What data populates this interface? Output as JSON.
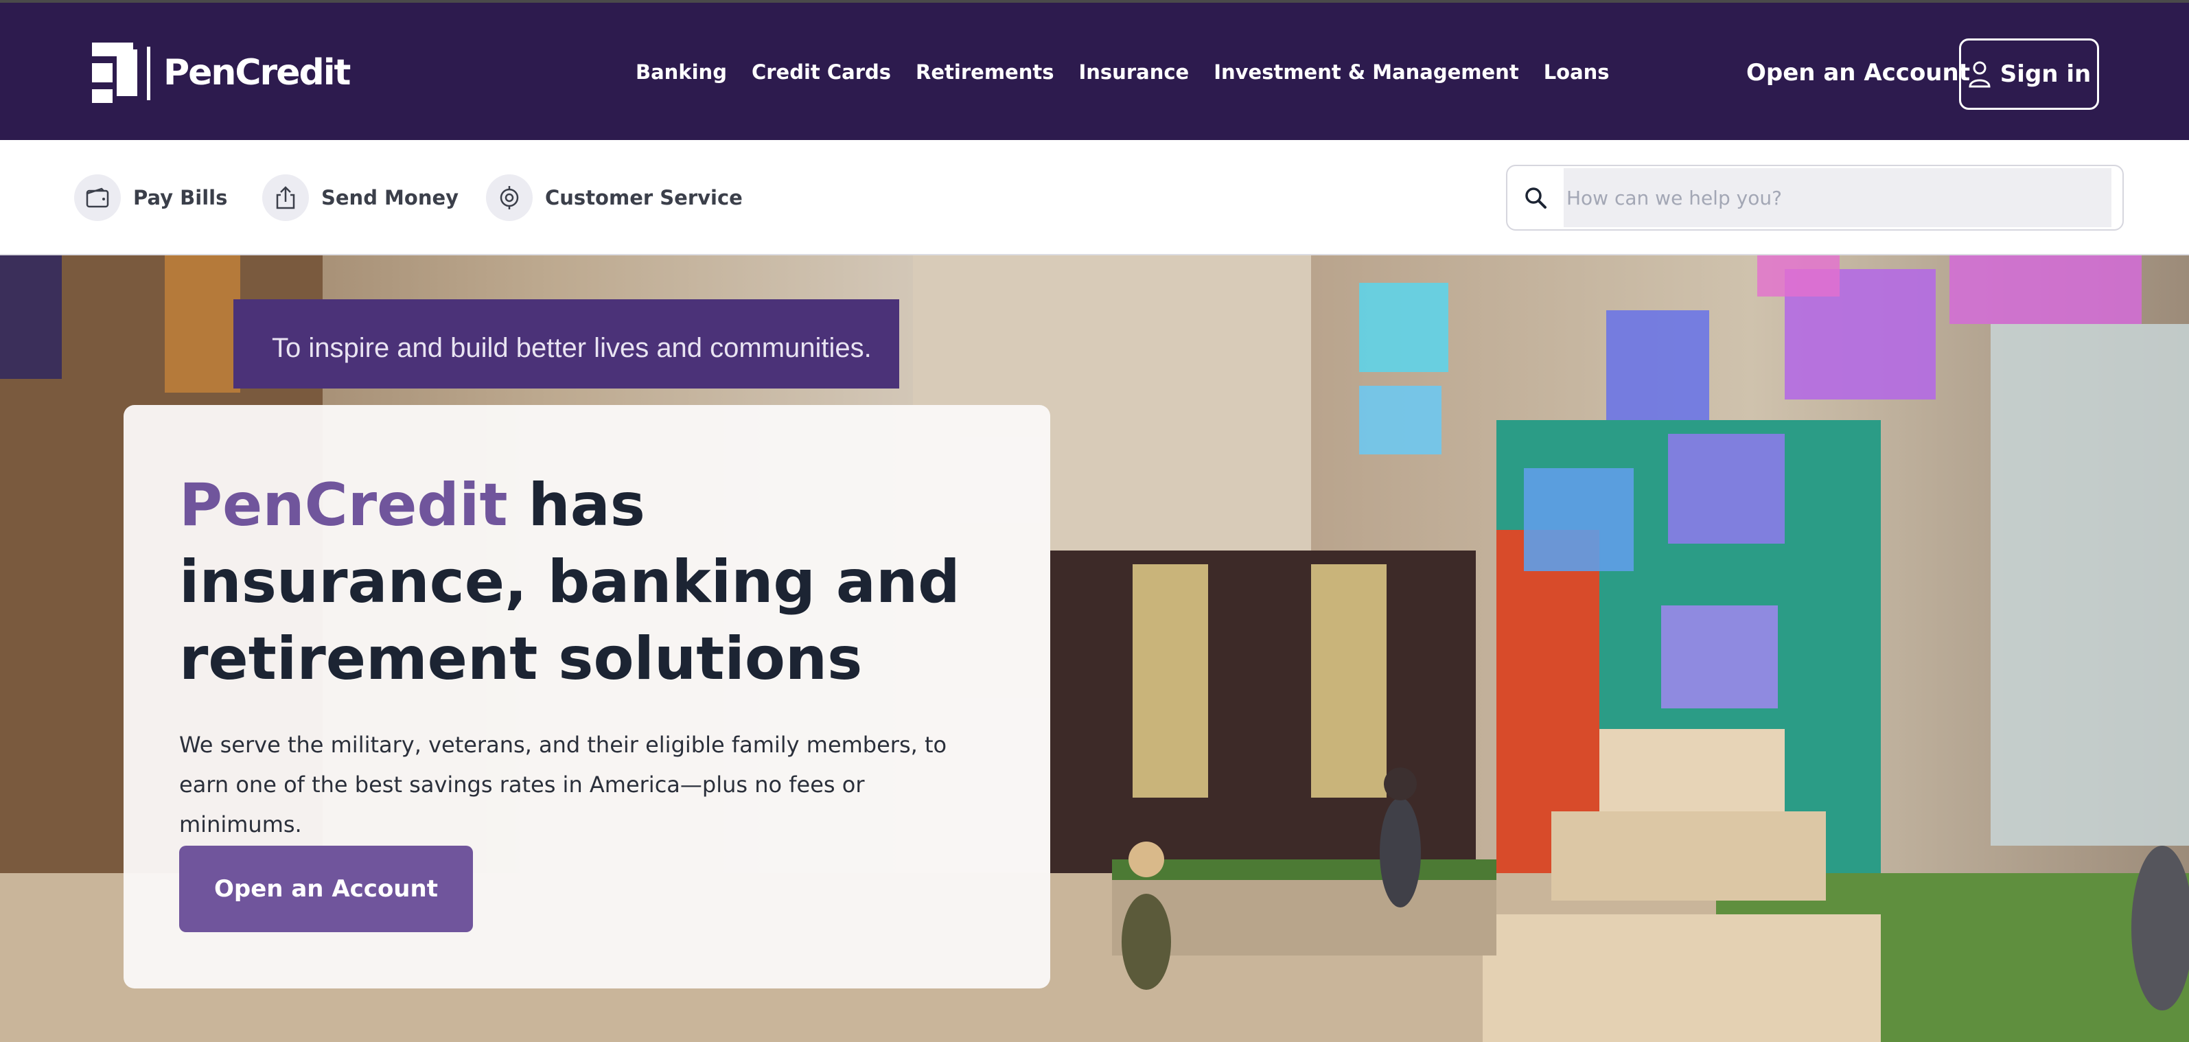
{
  "brand": {
    "name": "PenCredit",
    "accent": "#70559c",
    "nav_bg": "#2d1b4e"
  },
  "nav": {
    "items": [
      {
        "label": "Banking"
      },
      {
        "label": "Credit Cards"
      },
      {
        "label": "Retirements"
      },
      {
        "label": "Insurance"
      },
      {
        "label": "Investment & Management"
      },
      {
        "label": "Loans"
      }
    ],
    "open_account": "Open an Account",
    "sign_in": "Sign in",
    "sign_in_icon": "user-icon"
  },
  "quick_links": [
    {
      "label": "Pay Bills",
      "icon": "wallet-icon"
    },
    {
      "label": "Send Money",
      "icon": "share-icon"
    },
    {
      "label": "Customer Service",
      "icon": "support-icon"
    }
  ],
  "search": {
    "placeholder": "How can we help you?",
    "icon": "search-icon"
  },
  "hero": {
    "banner_text": "To inspire and build better lives and communities.",
    "headline_brand": "PenCredit",
    "headline_rest": " has insurance, banking and retirement solutions",
    "description": "We serve the military, veterans, and their eligible family members, to earn one of the best savings rates in America—plus no fees or minimums.",
    "cta": "Open an Account"
  }
}
